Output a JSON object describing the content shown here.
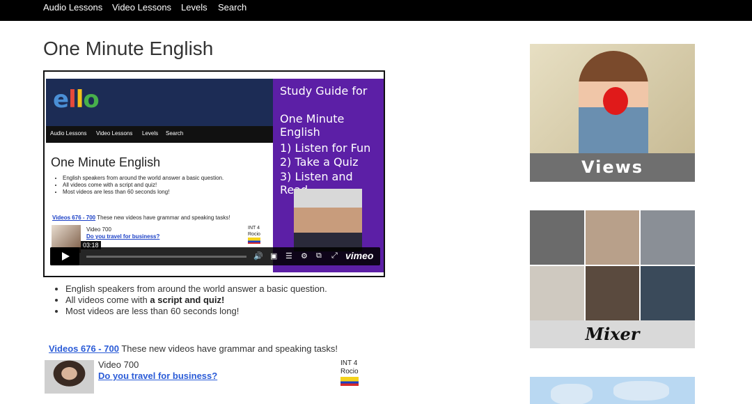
{
  "nav": {
    "items": [
      "Audio Lessons",
      "Video Lessons",
      "Levels",
      "Search"
    ]
  },
  "page": {
    "title": "One Minute English"
  },
  "video": {
    "logo": [
      "e",
      "l",
      "l",
      "o"
    ],
    "nav_items": [
      "Audio Lessons",
      "Video Lessons",
      "Levels",
      "Search"
    ],
    "title": "One Minute English",
    "bullets": [
      "English speakers from around the world answer a basic question.",
      "All videos come with a script and quiz!",
      "Most videos are less than 60 seconds long!"
    ],
    "link_label": "Videos 676 - 700",
    "link_rest": "These new videos have grammar and speaking tasks!",
    "entry_label": "Video 700",
    "entry_question": "Do you travel for business?",
    "entry_level": "INT 4",
    "entry_speaker": "Rocio",
    "timestamp": "03:18",
    "study_guide": [
      "Study Guide for",
      "One Minute English",
      "1) Listen for Fun",
      "2) Take a Quiz",
      "3) Listen and Read"
    ],
    "brand": "vimeo"
  },
  "bullets": {
    "item1": "English speakers from around the world answer a basic question.",
    "item2_pre": "All videos come with ",
    "item2_bold": "a script and quiz!",
    "item3": "Most videos are less than 60 seconds long!"
  },
  "videos": {
    "link": "Videos 676 - 700",
    "desc": " These new videos have grammar and speaking tasks!"
  },
  "entry": {
    "label": "Video 700",
    "question": "Do you travel for business?",
    "level": "INT 4",
    "speaker": "Rocio"
  },
  "sidebar": {
    "views_label": "Views",
    "mixer_label": "Mixer",
    "mixer_colors": [
      "#6b6b6b",
      "#b8a08a",
      "#8a8f96",
      "#cfc9c0",
      "#5a4a3e",
      "#3a4a5a"
    ]
  },
  "colors": {
    "nav_bg": "#000000",
    "link_blue": "#2a5bd7",
    "study_purple": "#5c1fa6"
  }
}
